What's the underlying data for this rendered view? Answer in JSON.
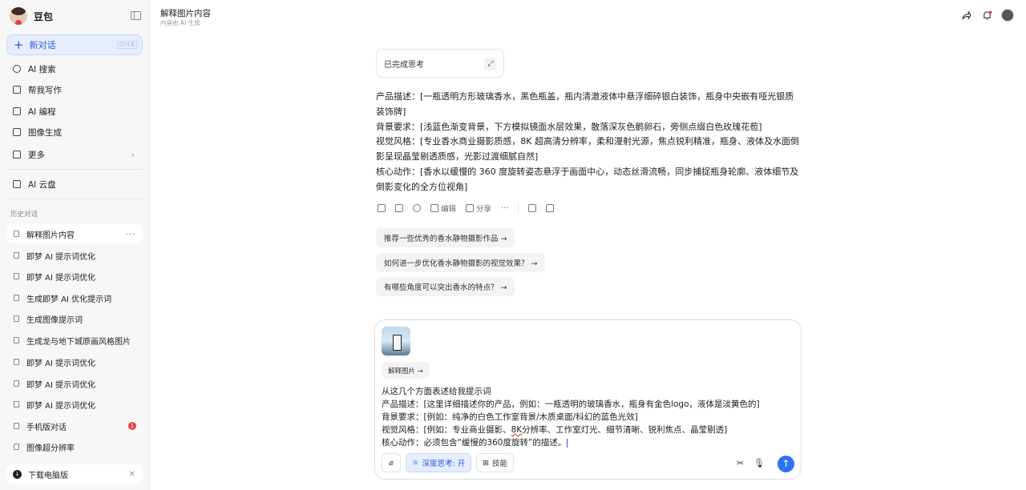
{
  "sidebar": {
    "brand": "豆包",
    "new_chat": "新对话",
    "shortcut": "Ctrl K",
    "nav": [
      "AI 搜索",
      "帮我写作",
      "AI 编程",
      "图像生成",
      "更多"
    ],
    "cloud": "AI 云盘",
    "history_title": "历史对话",
    "history": [
      "解释图片内容",
      "即梦 AI 提示词优化",
      "即梦 AI 提示词优化",
      "生成即梦 AI 优化提示词",
      "生成图像提示词",
      "生成龙与地下城原画风格图片",
      "即梦 AI 提示词优化",
      "即梦 AI 提示词优化",
      "即梦 AI 提示词优化",
      "手机版对话",
      "图像超分辨率"
    ],
    "unread_count": "1",
    "download": "下载电脑版"
  },
  "header": {
    "title": "解释图片内容",
    "subtitle": "内容由 AI 生成"
  },
  "main": {
    "thinking": "已完成思考",
    "answer": [
      "产品描述：[一瓶透明方形玻璃香水，黑色瓶盖，瓶内清澈液体中悬浮细碎银白装饰，瓶身中央嵌有哑光银质装饰牌]",
      "背景要求：[浅蓝色渐变背景，下方模拟镜面水层效果，散落深灰色鹅卵石，旁侧点缀白色玫瑰花苞]",
      "视觉风格：[专业香水商业摄影质感，8K 超高清分辨率，柔和漫射光源，焦点锐利精准，瓶身、液体及水面倒影呈现晶莹剔透质感，光影过渡细腻自然]",
      "核心动作：[香水以缓慢的 360 度旋转姿态悬浮于画面中心，动态丝滑流畅，同步捕捉瓶身轮廓、液体细节及倒影变化的全方位视角]"
    ],
    "edit_label": "编辑",
    "share_label": "分享",
    "suggestions": [
      "推荐一些优秀的香水静物摄影作品 →",
      "如何进一步优化香水静物摄影的视觉效果？ →",
      "有哪些角度可以突出香水的特点？ →"
    ]
  },
  "composer": {
    "attachment_label": "解释图片 →",
    "prompt_line1": "从这几个方面表述给我提示词",
    "prompt_line2": "产品描述：[这里详细描述你的产品，例如：一瓶透明的玻璃香水，瓶身有金色logo，液体是淡黄色的]",
    "prompt_line3": "背景要求：[例如：纯净的白色工作室背景/木质桌面/科幻的蓝色光效]",
    "prompt_line4a": "视觉风格：[例如：专业商业摄影、",
    "prompt_line4b": "8K",
    "prompt_line4c": "分辨率、工作室灯光、细节清晰、锐利焦点、晶莹剔透]",
    "prompt_line5": "核心动作：必须包含“缓慢的360度旋转”的描述。",
    "deep_think": "深度思考: 开",
    "skills": "技能"
  },
  "colors": {
    "accent": "#2a59e8",
    "send": "#2a74f0",
    "badge": "#e5453a"
  }
}
